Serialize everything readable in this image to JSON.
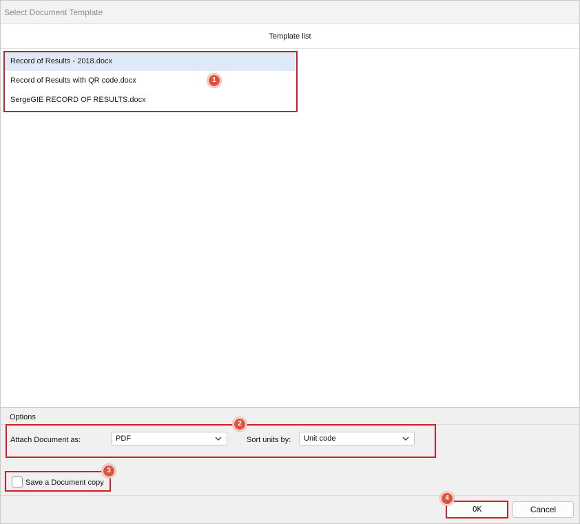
{
  "window": {
    "title": "Select Document Template"
  },
  "template_list": {
    "header": "Template list",
    "items": [
      {
        "label": "Record of Results - 2018.docx",
        "selected": true
      },
      {
        "label": "Record of Results with QR code.docx",
        "selected": false
      },
      {
        "label": "SergeGIE RECORD OF RESULTS.docx",
        "selected": false
      }
    ]
  },
  "options": {
    "section_label": "Options",
    "attach_label": "Attach Document as:",
    "attach_value": "PDF",
    "sort_label": "Sort units by:",
    "sort_value": "Unit code",
    "save_copy_label": "Save a Document copy",
    "save_copy_checked": false
  },
  "buttons": {
    "ok": "OK",
    "cancel": "Cancel"
  },
  "annotations": {
    "color": "#d01d2b",
    "badge_color": "#d9553f",
    "badges": [
      "1",
      "2",
      "3",
      "4"
    ]
  },
  "icons": {
    "dropdown": "chevron-down-icon"
  }
}
